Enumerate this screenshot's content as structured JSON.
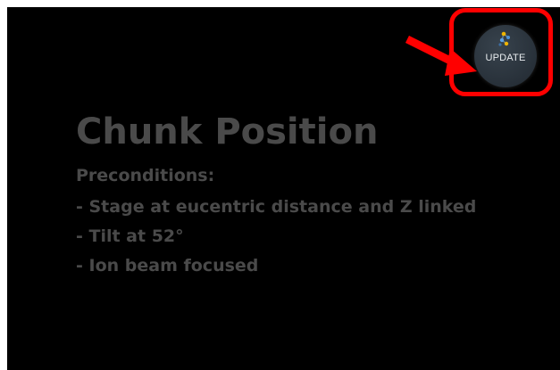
{
  "slide": {
    "title": "Chunk Position",
    "preconditions_heading": "Preconditions:",
    "preconditions": [
      "- Stage at eucentric distance and Z linked",
      "- Tilt at 52°",
      "- Ion beam focused"
    ]
  },
  "update_button": {
    "label": "UPDATE",
    "icon": "update-icon"
  },
  "annotation": {
    "highlight_color": "#ff0000"
  }
}
